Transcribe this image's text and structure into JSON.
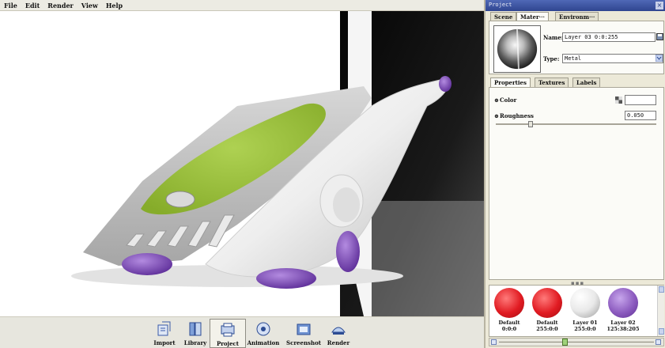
{
  "menu": [
    "File",
    "Edit",
    "Render",
    "View",
    "Help"
  ],
  "toolbar": [
    {
      "label": "Import",
      "icon": "import-icon"
    },
    {
      "label": "Library",
      "icon": "library-icon"
    },
    {
      "label": "Project",
      "icon": "project-icon",
      "active": true
    },
    {
      "label": "Animation",
      "icon": "animation-icon"
    },
    {
      "label": "Screenshot",
      "icon": "screenshot-icon"
    },
    {
      "label": "Render",
      "icon": "render-icon"
    }
  ],
  "panel": {
    "title": "Project",
    "watermark": "",
    "watermark_site": "",
    "top_tabs": [
      "Scene",
      "Mater···",
      "Environm···"
    ],
    "active_top_tab": 1,
    "name_label": "Name:",
    "name_value": "Layer 03 0:0:255",
    "type_label": "Type:",
    "type_value": "Metal",
    "sub_tabs": [
      "Properties",
      "Textures",
      "Labels"
    ],
    "active_sub_tab": 0,
    "color_label": "Color",
    "roughness_label": "Roughness",
    "roughness_value": "0.050",
    "roughness_slider": 0.05,
    "library": [
      {
        "line1": "Default",
        "line2": "0:0:0",
        "color": "#e11b22"
      },
      {
        "line1": "Default",
        "line2": "255:0:0",
        "color": "#e11b22"
      },
      {
        "line1": "Layer 01",
        "line2": "255:0:0",
        "color": "#f2f2f2"
      },
      {
        "line1": "Layer 02",
        "line2": "125:38:205",
        "color": "#8c5bbf"
      }
    ]
  },
  "colors": {
    "accent_green": "#9cc33a",
    "accent_purple": "#8a5cc0",
    "panel_bg": "#ece9d8"
  }
}
